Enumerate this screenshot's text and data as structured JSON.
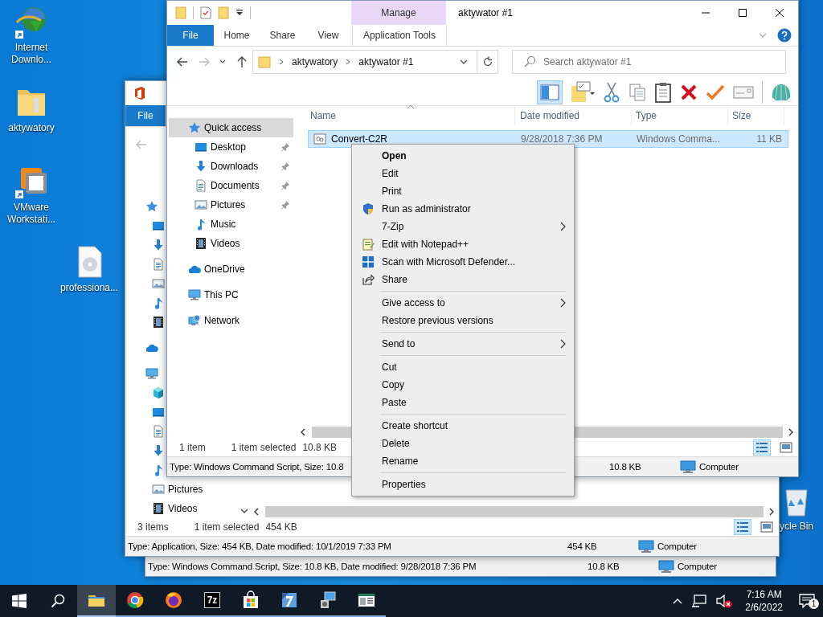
{
  "desktop_icons": [
    {
      "label": "Internet Downlo...",
      "kind": "globe"
    },
    {
      "label": "aktywatory",
      "kind": "folder"
    },
    {
      "label": "VMware Workstati...",
      "kind": "vm"
    },
    {
      "label": "professiona...",
      "kind": "disc"
    },
    {
      "label": "ycle Bin",
      "kind": "bin"
    }
  ],
  "back_window": {
    "status_bar": {
      "info": "Type: Windows Command Script, Size: 10.8 KB, Date modified: 9/28/2018 7:36 PM",
      "size": "10.8 KB",
      "location": "Computer"
    }
  },
  "middle_window": {
    "ribbon_tab": "File",
    "nav_items": [
      {
        "kind": "star",
        "children": [
          {
            "kind": "desktop"
          },
          {
            "kind": "download"
          },
          {
            "kind": "document"
          },
          {
            "kind": "pictures"
          },
          {
            "kind": "music"
          },
          {
            "kind": "videos"
          }
        ]
      },
      {
        "kind": "onedrive"
      },
      {
        "kind": "pc",
        "children": [
          {
            "kind": "cube"
          },
          {
            "kind": "desktop"
          },
          {
            "kind": "document"
          },
          {
            "kind": "download"
          },
          {
            "kind": "music"
          },
          {
            "kind": "pictures",
            "label": "Pictures"
          },
          {
            "kind": "videos",
            "label": "Videos"
          }
        ]
      }
    ],
    "status_line": {
      "count": "3 items",
      "selection": "1 item selected",
      "size": "454 KB"
    },
    "views": [
      {
        "kind": "details",
        "selected": true
      },
      {
        "kind": "preview",
        "selected": false
      }
    ],
    "status_bar": {
      "info": "Type: Application, Size: 454 KB, Date modified: 10/1/2019 7:33 PM",
      "size": "454 KB",
      "location": "Computer"
    }
  },
  "front_window": {
    "title": "aktywator #1",
    "contextual_header": "Manage",
    "tabs": [
      {
        "label": "File",
        "kind": "file",
        "selected": false
      },
      {
        "label": "Home",
        "kind": "plain",
        "selected": false
      },
      {
        "label": "Share",
        "kind": "plain",
        "selected": false
      },
      {
        "label": "View",
        "kind": "plain",
        "selected": false
      },
      {
        "label": "Application Tools",
        "kind": "contextual",
        "selected": false
      }
    ],
    "nav_buttons": {
      "back_disabled": false,
      "forward_disabled": true
    },
    "breadcrumbs": [
      "aktywatory",
      "aktywator #1"
    ],
    "search": {
      "placeholder": "Search aktywator #1"
    },
    "toolbar": {
      "preview_pane_on": true
    },
    "nav_items": [
      {
        "label": "Quick access",
        "kind": "star",
        "selected": true,
        "children": [
          {
            "label": "Desktop",
            "kind": "desktop",
            "selected": false,
            "pinned": true
          },
          {
            "label": "Downloads",
            "kind": "download",
            "selected": false,
            "pinned": true
          },
          {
            "label": "Documents",
            "kind": "document",
            "selected": false,
            "pinned": true
          },
          {
            "label": "Pictures",
            "kind": "pictures",
            "selected": false,
            "pinned": true
          },
          {
            "label": "Music",
            "kind": "music",
            "selected": false,
            "pinned": false
          },
          {
            "label": "Videos",
            "kind": "videos",
            "selected": false,
            "pinned": false
          }
        ]
      },
      {
        "label": "OneDrive",
        "kind": "onedrive",
        "selected": false
      },
      {
        "label": "This PC",
        "kind": "pc",
        "selected": false
      },
      {
        "label": "Network",
        "kind": "network",
        "selected": false
      }
    ],
    "table": {
      "columns": [
        "Name",
        "Date modified",
        "Type",
        "Size"
      ],
      "rows": [
        {
          "name": "Convert-C2R",
          "date": "9/28/2018 7:36 PM",
          "type": "Windows Comma...",
          "size": "11 KB",
          "selected": true
        }
      ]
    },
    "status_line": {
      "count": "1 item",
      "selection": "1 item selected",
      "size": "10.8 KB"
    },
    "views": [
      {
        "kind": "details",
        "selected": true
      },
      {
        "kind": "preview",
        "selected": false
      }
    ],
    "status_bar": {
      "info": "Type: Windows Command Script, Size: 10.8",
      "size": "10.8 KB",
      "location": "Computer"
    }
  },
  "context_menu": {
    "groups": [
      {
        "items": [
          {
            "label": "Open",
            "kind": "plain",
            "default": true,
            "submenu": false
          },
          {
            "label": "Edit",
            "kind": "plain",
            "default": false,
            "submenu": false
          },
          {
            "label": "Print",
            "kind": "plain",
            "default": false,
            "submenu": false
          },
          {
            "label": "Run as administrator",
            "kind": "admin",
            "default": false,
            "submenu": false
          },
          {
            "label": "7-Zip",
            "kind": "plain",
            "default": false,
            "submenu": true
          },
          {
            "label": "Edit with Notepad++",
            "kind": "notepad",
            "default": false,
            "submenu": false
          },
          {
            "label": "Scan with Microsoft Defender...",
            "kind": "defender",
            "default": false,
            "submenu": false
          },
          {
            "label": "Share",
            "kind": "share",
            "default": false,
            "submenu": false
          }
        ]
      },
      {
        "items": [
          {
            "label": "Give access to",
            "kind": "plain",
            "default": false,
            "submenu": true
          },
          {
            "label": "Restore previous versions",
            "kind": "plain",
            "default": false,
            "submenu": false
          }
        ]
      },
      {
        "items": [
          {
            "label": "Send to",
            "kind": "plain",
            "default": false,
            "submenu": true
          }
        ]
      },
      {
        "items": [
          {
            "label": "Cut",
            "kind": "plain",
            "default": false,
            "submenu": false
          },
          {
            "label": "Copy",
            "kind": "plain",
            "default": false,
            "submenu": false
          },
          {
            "label": "Paste",
            "kind": "plain",
            "default": false,
            "submenu": false
          }
        ]
      },
      {
        "items": [
          {
            "label": "Create shortcut",
            "kind": "plain",
            "default": false,
            "submenu": false
          },
          {
            "label": "Delete",
            "kind": "plain",
            "default": false,
            "submenu": false
          },
          {
            "label": "Rename",
            "kind": "plain",
            "default": false,
            "submenu": false
          }
        ]
      },
      {
        "items": [
          {
            "label": "Properties",
            "kind": "plain",
            "default": false,
            "submenu": false
          }
        ]
      }
    ]
  },
  "taskbar": {
    "apps": [
      {
        "kind": "explorer",
        "selected": true
      },
      {
        "kind": "chrome",
        "selected": false
      },
      {
        "kind": "firefox",
        "selected": false
      },
      {
        "kind": "sevenzip",
        "label": "7z",
        "selected": false
      },
      {
        "kind": "store",
        "selected": false
      },
      {
        "kind": "seven",
        "selected": false
      },
      {
        "kind": "installer",
        "selected": false
      },
      {
        "kind": "reader",
        "selected": false
      }
    ],
    "muted": true,
    "time": "7:16 AM",
    "date": "2/6/2022",
    "notifications": "1"
  }
}
